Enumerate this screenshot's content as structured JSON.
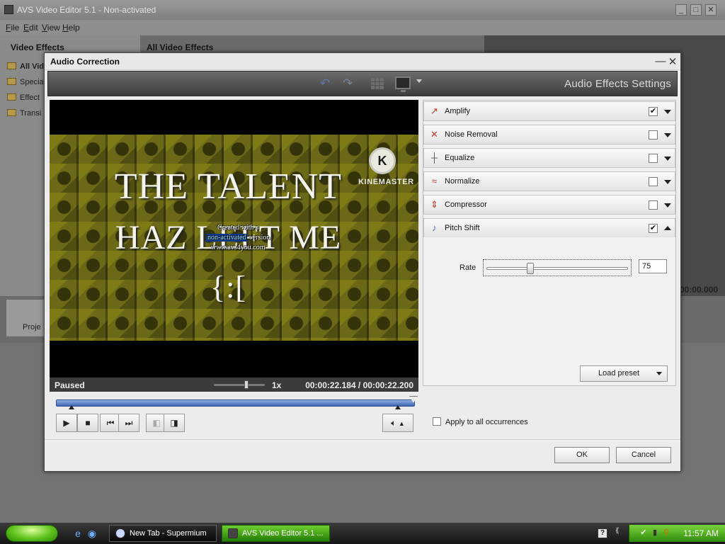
{
  "app": {
    "title": "AVS Video Editor 5.1 - Non-activated",
    "menu": [
      "File",
      "Edit",
      "View",
      "Help"
    ],
    "left_panel_title": "Video Effects",
    "right_panel_title": "All Video Effects",
    "tree_items": [
      "All Vide",
      "Specia",
      "Effect",
      "Transi"
    ],
    "bg_timecode": "00:00:00.000",
    "bg_button_label": "Proje"
  },
  "dialog": {
    "title": "Audio Correction",
    "settings_title": "Audio Effects Settings",
    "minimize_glyph": "—",
    "close_glyph": "✕"
  },
  "video": {
    "text_line1": "THE TALENT",
    "text_line2": "HAZ LEFT ME",
    "text_line3": "{:[",
    "logo_letter": "K",
    "logo_text": "KINEMASTER",
    "watermark_line1": "Created with a",
    "watermark_highlight": "non-activated",
    "watermark_after_highlight": "version",
    "watermark_line3": "www.avs4you.com"
  },
  "player": {
    "status": "Paused",
    "speed": "1x",
    "timecode": "00:00:22.184 / 00:00:22.200",
    "speed_position": 0.6,
    "seek_position": 1.0
  },
  "effects": [
    {
      "name": "Amplify",
      "checked": true,
      "icon": "amplify-icon",
      "glyph": "↗",
      "color": "#c0392b"
    },
    {
      "name": "Noise Removal",
      "checked": false,
      "icon": "noise-removal-icon",
      "glyph": "✕",
      "color": "#c0392b"
    },
    {
      "name": "Equalize",
      "checked": false,
      "icon": "equalize-icon",
      "glyph": "┼",
      "color": "#555555"
    },
    {
      "name": "Normalize",
      "checked": false,
      "icon": "normalize-icon",
      "glyph": "≈",
      "color": "#c0392b"
    },
    {
      "name": "Compressor",
      "checked": false,
      "icon": "compressor-icon",
      "glyph": "⇕",
      "color": "#c0392b"
    },
    {
      "name": "Pitch Shift",
      "checked": true,
      "icon": "pitch-shift-icon",
      "glyph": "♪",
      "color": "#4a6fa5",
      "expanded": true
    }
  ],
  "pitch_shift": {
    "rate_label": "Rate",
    "rate_value": "75",
    "load_preset_label": "Load preset"
  },
  "apply_all_label": "Apply to all occurrences",
  "buttons": {
    "ok": "OK",
    "cancel": "Cancel"
  },
  "taskbar": {
    "tasks": [
      "New Tab - Supermium",
      "AVS Video Editor 5.1 ..."
    ],
    "clock": "11:57 AM",
    "tray_extra": "?"
  },
  "colors": {
    "accent_blue": "#3f68b4",
    "taskbar_green": "#2f8c0d",
    "video_olive": "#4f4d10"
  }
}
